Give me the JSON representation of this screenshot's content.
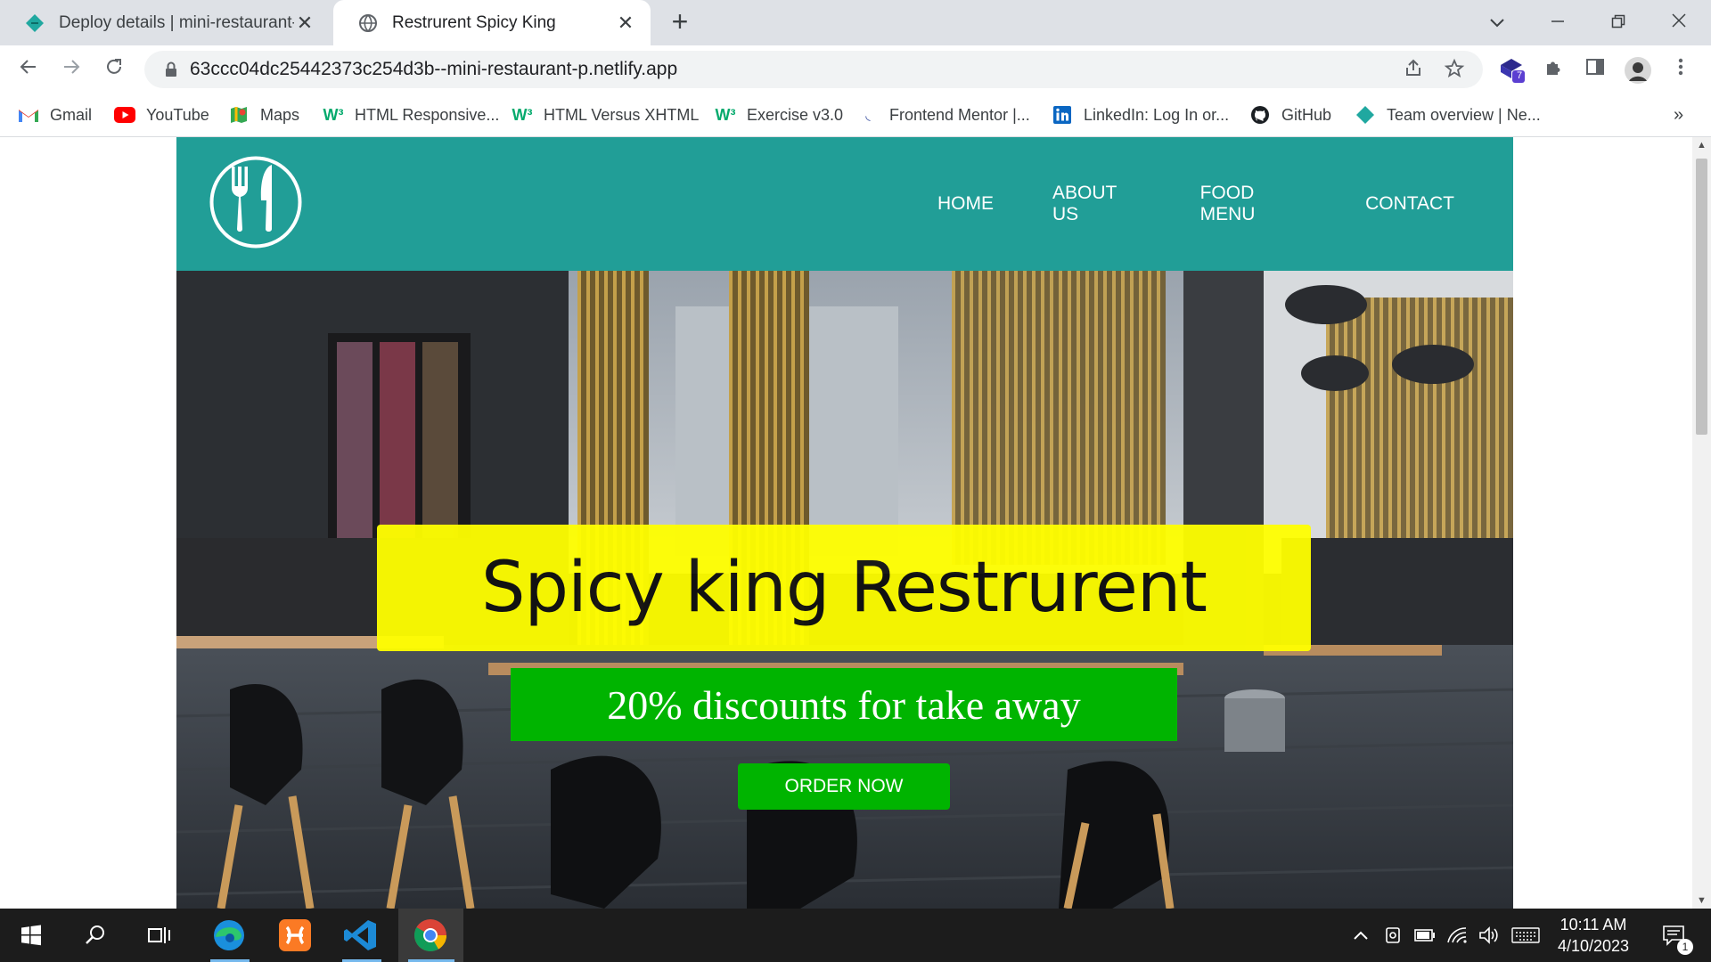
{
  "browser": {
    "tabs": [
      {
        "title": "Deploy details | mini-restaurant-p",
        "icon": "netlify-icon"
      },
      {
        "title": "Restrurent Spicy King",
        "icon": "globe-icon"
      }
    ],
    "address": "63ccc04dc25442373c254d3b--mini-restaurant-p.netlify.app",
    "extension_badge": "7",
    "bookmarks": [
      {
        "label": "Gmail",
        "icon": "gmail-icon"
      },
      {
        "label": "YouTube",
        "icon": "youtube-icon"
      },
      {
        "label": "Maps",
        "icon": "maps-icon"
      },
      {
        "label": "HTML Responsive...",
        "icon": "w3schools-icon"
      },
      {
        "label": "HTML Versus XHTML",
        "icon": "w3schools-icon"
      },
      {
        "label": "Exercise v3.0",
        "icon": "w3schools-icon"
      },
      {
        "label": "Frontend Mentor |...",
        "icon": "frontend-mentor-icon"
      },
      {
        "label": "LinkedIn: Log In or...",
        "icon": "linkedin-icon"
      },
      {
        "label": "GitHub",
        "icon": "github-icon"
      },
      {
        "label": "Team overview | Ne...",
        "icon": "netlify-icon"
      }
    ],
    "bookmarks_overflow": "»"
  },
  "site": {
    "nav": [
      "HOME",
      "ABOUT US",
      "FOOD MENU",
      "CONTACT"
    ],
    "headline": "Spicy king Restrurent",
    "discount": "20% discounts for take away",
    "cta": "ORDER NOW",
    "colors": {
      "header": "#219e97",
      "headline_bg": "#ffff00",
      "discount_bg": "#00b400"
    }
  },
  "taskbar": {
    "time": "10:11 AM",
    "date": "4/10/2023",
    "notification_count": "1"
  }
}
